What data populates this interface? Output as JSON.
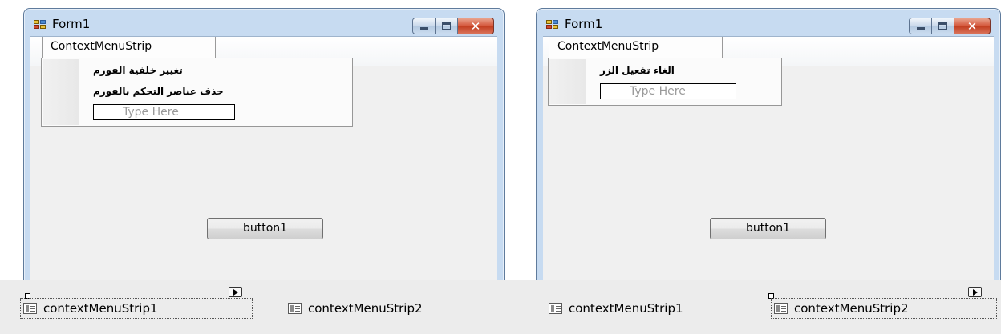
{
  "left": {
    "window": {
      "title": "Form1",
      "close_glyph": "✕"
    },
    "context_menu_tab": "ContextMenuStrip",
    "menu_items": [
      "تغيير خلفية الفورم",
      "حذف عناصر التحكم بالفورم"
    ],
    "type_here": "Type Here",
    "button_label": "button1",
    "tray": {
      "items": [
        "contextMenuStrip1",
        "contextMenuStrip2"
      ],
      "selected": "contextMenuStrip1"
    }
  },
  "right": {
    "window": {
      "title": "Form1",
      "close_glyph": "✕"
    },
    "context_menu_tab": "ContextMenuStrip",
    "menu_items": [
      "الغاء تفعيل الزر"
    ],
    "type_here": "Type Here",
    "button_label": "button1",
    "tray": {
      "items": [
        "contextMenuStrip1",
        "contextMenuStrip2"
      ],
      "selected": "contextMenuStrip2"
    }
  },
  "icons": {
    "app_icon": "windows-form-icon",
    "tray_item_icon": "context-menu-strip-icon",
    "smart_tag": "smart-tag-arrow-icon"
  },
  "colors": {
    "window_frame": "#c7dbf1",
    "close_button": "#c23c1e",
    "client_area": "#f0f0f0"
  }
}
